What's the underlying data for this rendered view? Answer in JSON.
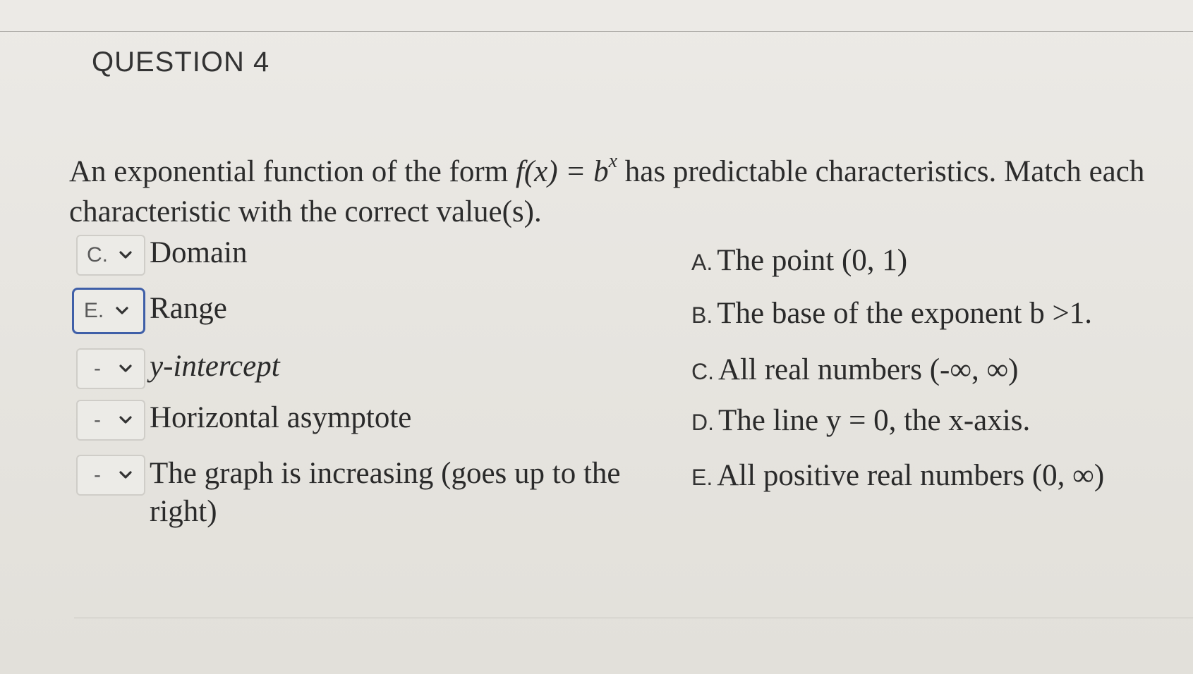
{
  "question": {
    "heading": "QUESTION 4",
    "prompt_part1": "An exponential function of the form ",
    "prompt_fx": "f(x) = b",
    "prompt_exp": "x",
    "prompt_part2": " has predictable characteristics.  Match each",
    "prompt_line2": "characteristic with the correct value(s)."
  },
  "matches": [
    {
      "selected": "C.",
      "term": "Domain",
      "focused": false
    },
    {
      "selected": "E.",
      "term": "Range",
      "focused": true
    },
    {
      "selected": "-",
      "term": "y-intercept",
      "focused": false
    },
    {
      "selected": "-",
      "term": "Horizontal asymptote",
      "focused": false
    },
    {
      "selected": "-",
      "term": "The graph is increasing (goes up to the right)",
      "focused": false
    }
  ],
  "answers": [
    {
      "letter": "A.",
      "text": "The point (0, 1)"
    },
    {
      "letter": "B.",
      "text": "The base of the exponent b >1."
    },
    {
      "letter": "C.",
      "text": "All real numbers (-∞, ∞)"
    },
    {
      "letter": "D.",
      "text": "The line y = 0, the x-axis."
    },
    {
      "letter": "E.",
      "text": "All positive real numbers (0, ∞)"
    }
  ],
  "icons": {
    "dropdown": "chevron-down-icon"
  },
  "colors": {
    "focus_border": "#3f5fa8",
    "background": "#e9e7e2"
  }
}
